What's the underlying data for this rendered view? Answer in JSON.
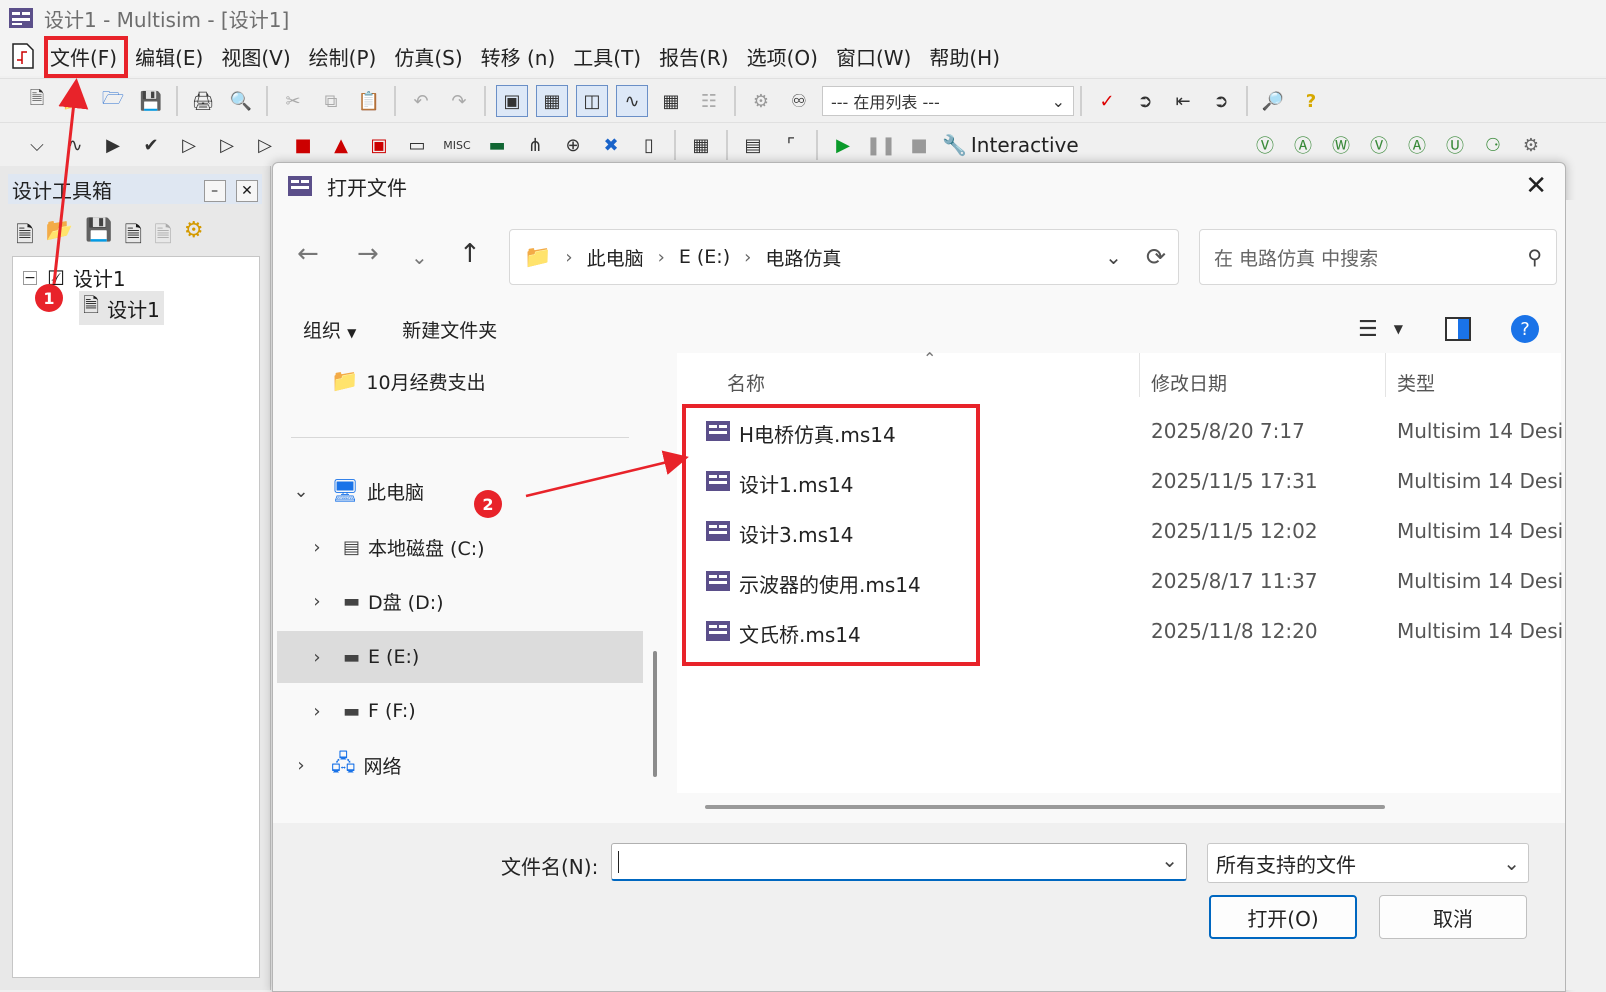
{
  "app": {
    "title": "设计1 - Multisim - [设计1]",
    "menu": [
      "文件(F)",
      "编辑(E)",
      "视图(V)",
      "绘制(P)",
      "仿真(S)",
      "转移 (n)",
      "工具(T)",
      "报告(R)",
      "选项(O)",
      "窗口(W)",
      "帮助(H)"
    ],
    "inuse_combo": "--- 在用列表 ---",
    "interactive_label": "Interactive",
    "misc_label": "MISC"
  },
  "toolbox": {
    "title": "设计工具箱",
    "tree_root": "设计1",
    "tree_child": "设计1"
  },
  "dialog": {
    "title": "打开文件",
    "breadcrumb": [
      "此电脑",
      "E (E:)",
      "电路仿真"
    ],
    "search_placeholder": "在 电路仿真 中搜索",
    "organize": "组织",
    "new_folder": "新建文件夹",
    "nav": {
      "folder": "10月经费支出",
      "this_pc": "此电脑",
      "drives": [
        "本地磁盘 (C:)",
        "D盘 (D:)",
        "E (E:)",
        "F (F:)"
      ],
      "network": "网络"
    },
    "columns": {
      "name": "名称",
      "date": "修改日期",
      "type": "类型"
    },
    "files": [
      {
        "name": "H电桥仿真.ms14",
        "date": "2025/8/20 7:17",
        "type": "Multisim 14 Desi"
      },
      {
        "name": "设计1.ms14",
        "date": "2025/11/5 17:31",
        "type": "Multisim 14 Desi"
      },
      {
        "name": "设计3.ms14",
        "date": "2025/11/5 12:02",
        "type": "Multisim 14 Desi"
      },
      {
        "name": "示波器的使用.ms14",
        "date": "2025/8/17 11:37",
        "type": "Multisim 14 Desi"
      },
      {
        "name": "文氏桥.ms14",
        "date": "2025/11/8 12:20",
        "type": "Multisim 14 Desi"
      }
    ],
    "filename_label": "文件名(N):",
    "filename_value": "",
    "filetype": "所有支持的文件",
    "open_btn": "打开(O)",
    "cancel_btn": "取消"
  },
  "annotations": {
    "badge1": "1",
    "badge2": "2"
  },
  "colors": {
    "annotation_red": "#e8232a",
    "accent_blue": "#0067c0"
  }
}
